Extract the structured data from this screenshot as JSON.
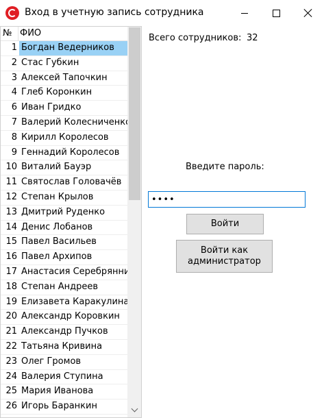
{
  "window": {
    "title": "Вход в учетную запись сотрудника",
    "icon": "app-logo-icon"
  },
  "list": {
    "columns": {
      "number": "№",
      "name": "ФИО"
    },
    "selected_index": 0,
    "scroll": {
      "position": 0,
      "visible_fraction": 0.45
    },
    "rows": [
      {
        "num": "1",
        "name": "Богдан Ведерников"
      },
      {
        "num": "2",
        "name": "Стас Губкин"
      },
      {
        "num": "3",
        "name": "Алексей Тапочкин"
      },
      {
        "num": "4",
        "name": "Глеб Коронкин"
      },
      {
        "num": "6",
        "name": "Иван Гридко"
      },
      {
        "num": "7",
        "name": "Валерий Колесниченко"
      },
      {
        "num": "8",
        "name": "Кирилл Королесов"
      },
      {
        "num": "9",
        "name": "Геннадий Королесов"
      },
      {
        "num": "10",
        "name": "Виталий Бауэр"
      },
      {
        "num": "11",
        "name": "Святослав Головачёв"
      },
      {
        "num": "12",
        "name": "Степан Крылов"
      },
      {
        "num": "13",
        "name": "Дмитрий Руденко"
      },
      {
        "num": "14",
        "name": "Денис Лобанов"
      },
      {
        "num": "15",
        "name": "Павел Васильев"
      },
      {
        "num": "16",
        "name": "Павел Архипов"
      },
      {
        "num": "17",
        "name": "Анастасия Серебрянникова"
      },
      {
        "num": "18",
        "name": "Степан Андреев"
      },
      {
        "num": "19",
        "name": "Елизавета Каракулина"
      },
      {
        "num": "20",
        "name": "Александр Коровкин"
      },
      {
        "num": "21",
        "name": "Александр Пучков"
      },
      {
        "num": "22",
        "name": "Татьяна Кривина"
      },
      {
        "num": "23",
        "name": "Олег Громов"
      },
      {
        "num": "24",
        "name": "Валерия Ступина"
      },
      {
        "num": "25",
        "name": "Мария Иванова"
      },
      {
        "num": "26",
        "name": "Игорь Баранкин"
      }
    ]
  },
  "summary": {
    "label": "Всего сотрудников:",
    "value": "32"
  },
  "login": {
    "password_label": "Введите пароль:",
    "password_value": "••••",
    "login_button": "Войти",
    "admin_button": "Войти как администратор"
  },
  "colors": {
    "selection": "#99d1f5",
    "input_focus_border": "#0078d7",
    "button_face": "#e1e1e1",
    "app_icon": "#e01e24"
  }
}
